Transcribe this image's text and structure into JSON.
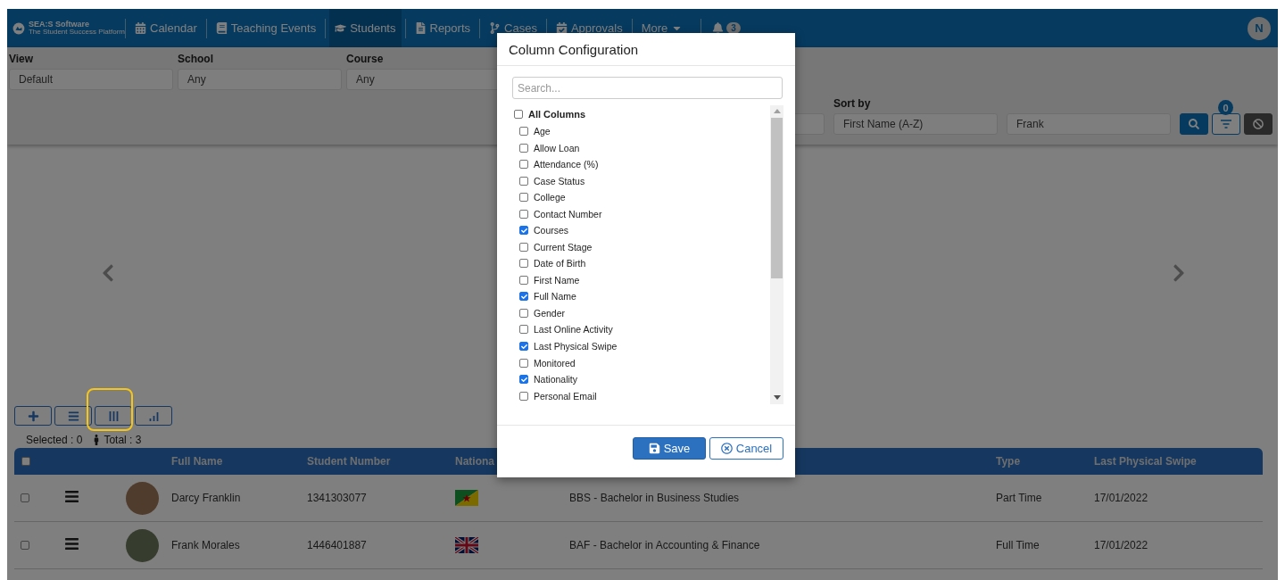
{
  "nav": {
    "logo": "SEA:S Software",
    "logo_tagline": "The Student Success Platform",
    "items": [
      {
        "label": "Calendar",
        "kind": "calendar",
        "selected": false
      },
      {
        "label": "Teaching Events",
        "kind": "book",
        "selected": false
      },
      {
        "label": "Students",
        "kind": "graduation",
        "selected": true
      },
      {
        "label": "Reports",
        "kind": "file",
        "selected": false
      },
      {
        "label": "Cases",
        "kind": "branch",
        "selected": false
      },
      {
        "label": "Approvals",
        "kind": "approval",
        "selected": false
      }
    ],
    "more": "More",
    "notifications": "3",
    "avatar": "N"
  },
  "filters": {
    "fields": [
      {
        "label": "View",
        "value": "Default"
      },
      {
        "label": "School",
        "value": "Any"
      },
      {
        "label": "Course",
        "value": "Any"
      }
    ],
    "sort_label": "Sort by",
    "sort_value": "First Name (A-Z)",
    "search_value": "Frank",
    "filter_count": "0"
  },
  "summary": {
    "selected": "Selected : 0",
    "total": "Total : 3"
  },
  "table": {
    "header_checked": false,
    "columns": [
      "Full Name",
      "Student Number",
      "Nationa",
      "Type",
      "Last Physical Swipe"
    ],
    "rows": [
      {
        "checked": false,
        "name": "Darcy Franklin",
        "number": "1341303077",
        "kind": "french-guiana",
        "course": "BBS - Bachelor in Business Studies",
        "type": "Part Time",
        "swipe": "17/01/2022"
      },
      {
        "checked": false,
        "name": "Frank Morales",
        "number": "1446401887",
        "kind": "uk",
        "course": "BAF - Bachelor in Accounting & Finance",
        "type": "Full Time",
        "swipe": "17/01/2022"
      }
    ]
  },
  "dialog": {
    "title": "Column Configuration",
    "search_placeholder": "Search...",
    "all_label": "All Columns",
    "all_checked": false,
    "columns": [
      {
        "label": "Age",
        "checked": false
      },
      {
        "label": "Allow Loan",
        "checked": false
      },
      {
        "label": "Attendance (%)",
        "checked": false
      },
      {
        "label": "Case Status",
        "checked": false
      },
      {
        "label": "College",
        "checked": false
      },
      {
        "label": "Contact Number",
        "checked": false
      },
      {
        "label": "Courses",
        "checked": true
      },
      {
        "label": "Current Stage",
        "checked": false
      },
      {
        "label": "Date of Birth",
        "checked": false
      },
      {
        "label": "First Name",
        "checked": false
      },
      {
        "label": "Full Name",
        "checked": true
      },
      {
        "label": "Gender",
        "checked": false
      },
      {
        "label": "Last Online Activity",
        "checked": false
      },
      {
        "label": "Last Physical Swipe",
        "checked": true
      },
      {
        "label": "Monitored",
        "checked": false
      },
      {
        "label": "Nationality",
        "checked": true
      },
      {
        "label": "Personal Email",
        "checked": false
      }
    ],
    "save": "Save",
    "cancel": "Cancel"
  }
}
